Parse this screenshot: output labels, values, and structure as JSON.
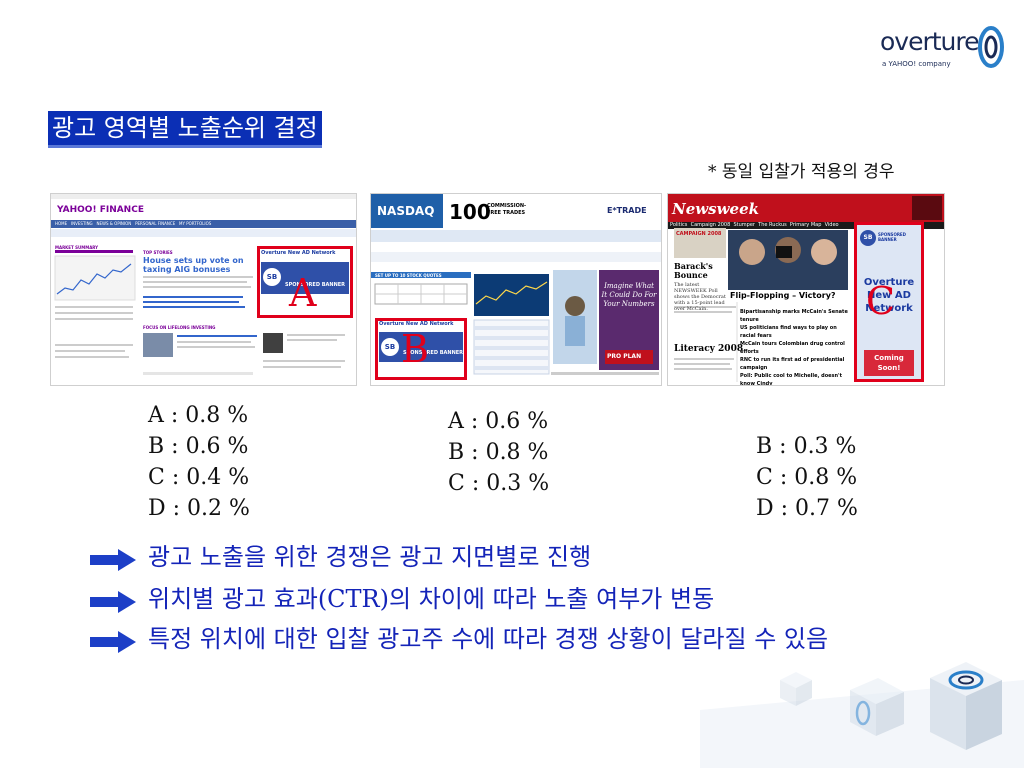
{
  "logo": {
    "word": "overture",
    "subtitle": "a YAHOO! company",
    "color": "#1a2a55",
    "ring_color": "#2a7fc9"
  },
  "heading": "광고 영역별 노출순위 결정",
  "note": "* 동일 입찰가 적용의 경우",
  "screenshots": {
    "yahoo": {
      "brand": "YAHOO! FINANCE",
      "tabs": [
        "HOME",
        "INVESTING",
        "NEWS & OPINION",
        "PERSONAL FINANCE",
        "MY PORTFOLIOS"
      ],
      "story_title": "House sets up vote on taxing AIG bonuses",
      "section_market": "MARKET SUMMARY",
      "section_top": "TOP STORIES",
      "section_focus": "FOCUS ON LIFELONG INVESTING",
      "ad_title": "Overture New AD Network",
      "ad_banner": "SPONSORED BANNER",
      "ad_badge": "SB",
      "highlight_letter": "A"
    },
    "nasdaq": {
      "brand": "NASDAQ",
      "promo_number": "100",
      "promo_text": "COMMISSION-FREE TRADES",
      "broker": "E*TRADE",
      "quotes_title": "SET UP TO 10 STOCK QUOTES",
      "side_ad_text": "Imagine What It Could Do For Your Numbers",
      "side_ad_brand": "PRO PLAN",
      "ad_title": "Overture New AD Network",
      "ad_banner": "SPONSORED BANNER",
      "ad_badge": "SB",
      "highlight_letter": "B"
    },
    "newsweek": {
      "brand": "Newsweek",
      "nav": [
        "Politics",
        "Campaign 2008",
        "Stumper",
        "The Ruckus",
        "Primary Map",
        "Video"
      ],
      "campaign_label": "CAMPAIGN 2008",
      "story_small": "Barack's Bounce",
      "story_small_desc": "The latest NEWSWEEK Poll shows the Democrat with a 15-point lead over McCain.",
      "story_main": "Flip-Flopping – Victory?",
      "literacy": "Literacy 2008",
      "headlines": [
        "Bipartisanship marks McCain's Senate tenure",
        "US politicians find ways to play on racial fears",
        "McCain tours Colombian drug control efforts",
        "RNC to run its first ad of presidential campaign",
        "Poll: Public cool to Michelle, doesn't know Cindy"
      ],
      "ad_label": "SPONSORED BANNER",
      "ad_text": "Overture New AD Network",
      "ad_badge": "SB",
      "ad_button": "Coming Soon!",
      "highlight_letter": "C"
    }
  },
  "rates": {
    "yahoo": [
      "A : 0.8 %",
      "B : 0.6 %",
      "C : 0.4 %",
      "D : 0.2 %"
    ],
    "nasdaq": [
      "A : 0.6 %",
      "B : 0.8 %",
      "C : 0.3 %"
    ],
    "newsweek": [
      "B : 0.3 %",
      "C : 0.8 %",
      "D : 0.7 %"
    ]
  },
  "bullets": [
    "광고 노출을 위한 경쟁은 광고 지면별로 진행",
    "위치별 광고 효과(CTR)의 차이에 따라 노출 여부가 변동",
    "특정 위치에 대한 입찰 광고주 수에 따라 경쟁 상황이 달라질 수 있음"
  ],
  "colors": {
    "heading_bg": "#0b2fb5",
    "bullet_text": "#1424b8",
    "highlight": "#e0001b",
    "arrow": "#1d3fc7"
  }
}
